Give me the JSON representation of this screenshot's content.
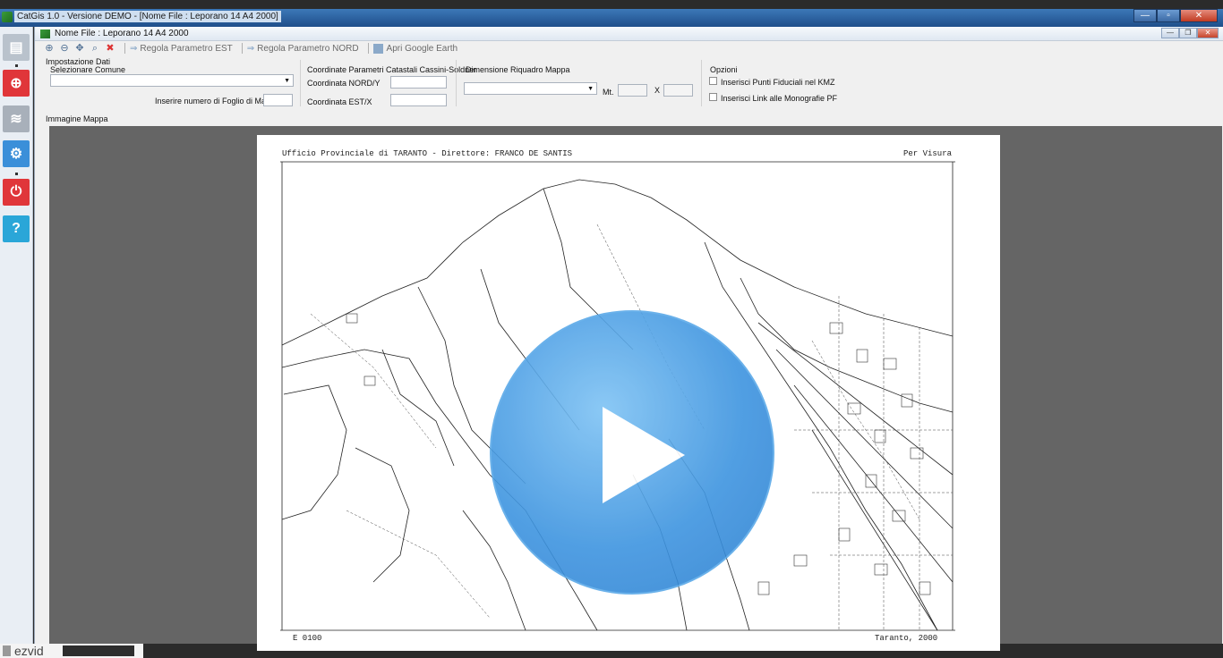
{
  "window": {
    "title": "CatGis 1.0 - Versione DEMO - [Nome File : Leporano 14 A4 2000]",
    "inner_title": "Nome File : Leporano 14 A4 2000"
  },
  "colors": {
    "titlebar": "#2a609f",
    "sidebar_red": "#e0363a",
    "sidebar_blue": "#3b8fd9",
    "sidebar_gray": "#a0a8b2",
    "play_blue": "#3f95e0"
  },
  "toolbar": {
    "regola_est": "Regola Parametro EST",
    "regola_nord": "Regola Parametro NORD",
    "apri_ge": "Apri  Google Earth"
  },
  "form": {
    "group_title": "Impostazione Dati",
    "comune_label": "Selezionare Comune",
    "comune_value": "",
    "foglio_label": "Inserire numero di Foglio di Mappa",
    "foglio_value": "",
    "coord_title": "Coordinate Parametri Catastali Cassini-Soldner",
    "nord_label": "Coordinata NORD/Y",
    "nord_value": "",
    "est_label": "Coordinata EST/X",
    "est_value": "",
    "dim_title": "Dimensione Riquadro Mappa",
    "dim_value": "",
    "mt_label": "Mt.",
    "x_label": "X",
    "opzioni_title": "Opzioni",
    "opt1": "Inserisci Punti  Fiduciali nel KMZ",
    "opt2": "Inserisci Link alle Monografie PF"
  },
  "map": {
    "label": "Immagine Mappa",
    "header_text": "Ufficio Provinciale di TARANTO - Direttore:   FRANCO  DE SANTIS",
    "per_visura": "Per Visura",
    "footer_left": "E 0100",
    "footer_right": "Taranto, 2000"
  },
  "overlay": {
    "brand": "ezvid"
  }
}
